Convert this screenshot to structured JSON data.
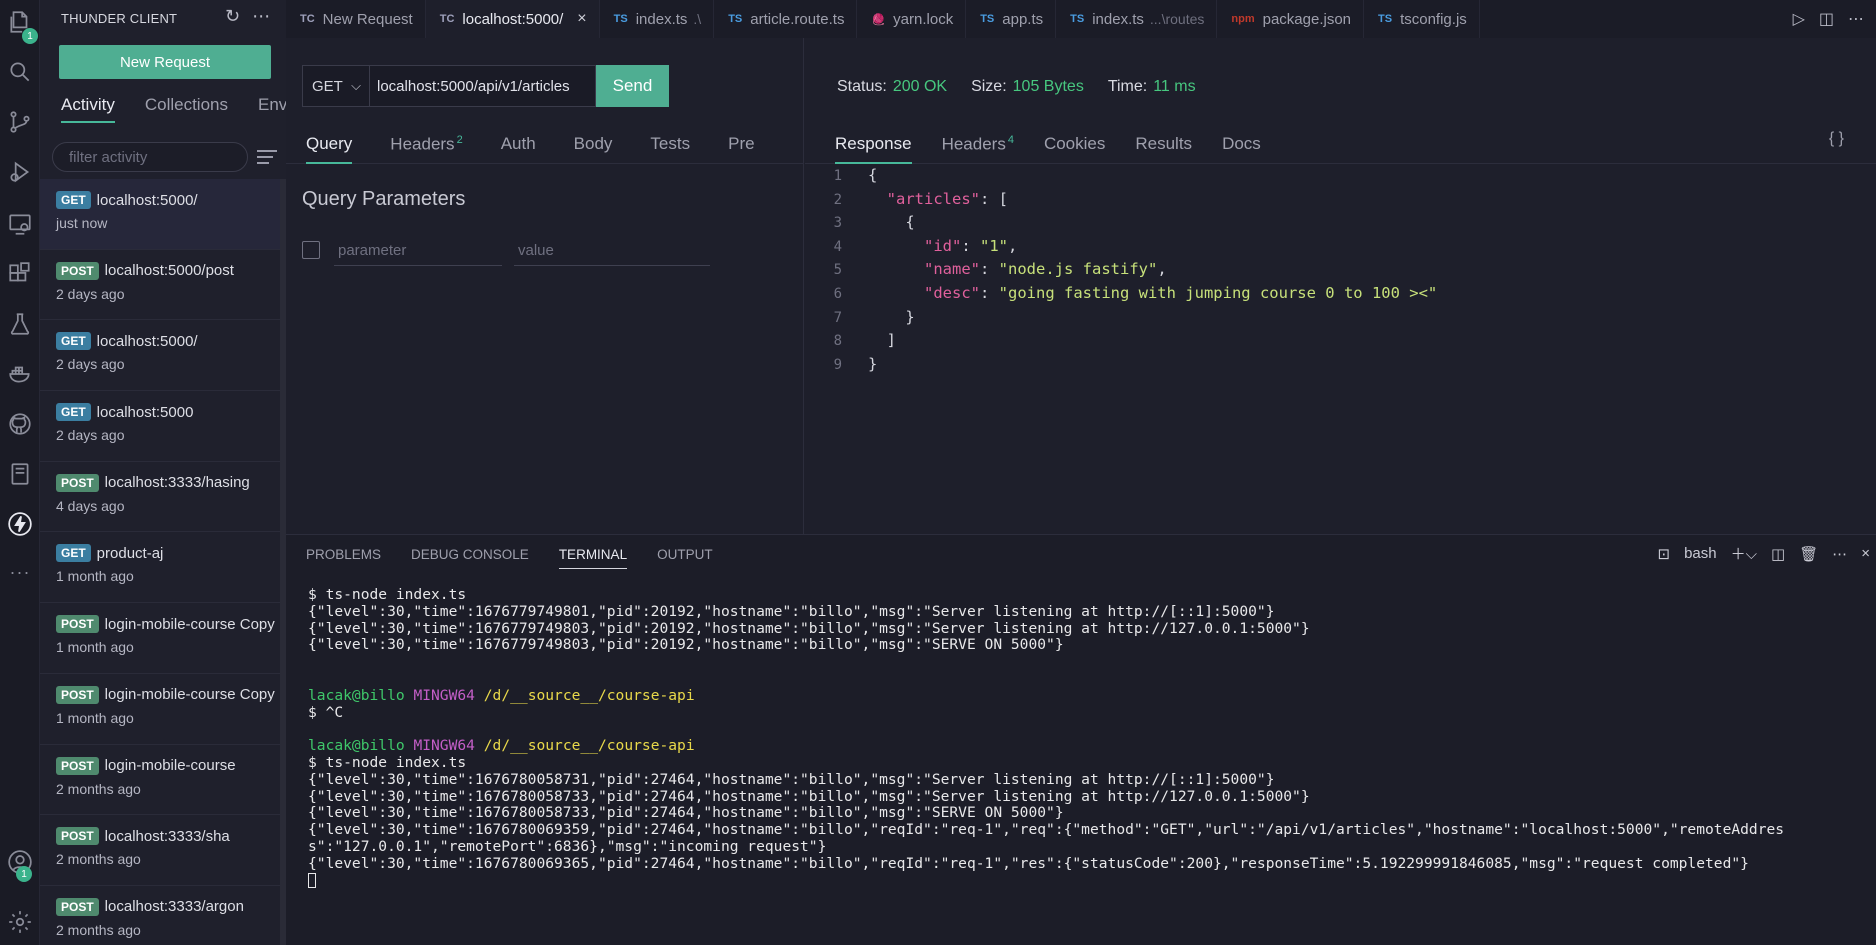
{
  "activity_bar": {
    "explorer_badge": "1",
    "account_badge": "1"
  },
  "sidebar": {
    "title": "THUNDER CLIENT",
    "new_request": "New Request",
    "tabs": [
      "Activity",
      "Collections",
      "Env"
    ],
    "filter_placeholder": "filter activity",
    "items": [
      {
        "method": "GET",
        "url": "localhost:5000/",
        "time": "just now"
      },
      {
        "method": "POST",
        "url": "localhost:5000/post",
        "time": "2 days ago"
      },
      {
        "method": "GET",
        "url": "localhost:5000/",
        "time": "2 days ago"
      },
      {
        "method": "GET",
        "url": "localhost:5000",
        "time": "2 days ago"
      },
      {
        "method": "POST",
        "url": "localhost:3333/hasing",
        "time": "4 days ago"
      },
      {
        "method": "GET",
        "url": "product-aj",
        "time": "1 month ago"
      },
      {
        "method": "POST",
        "url": "login-mobile-course Copy ...",
        "time": "1 month ago"
      },
      {
        "method": "POST",
        "url": "login-mobile-course Copy",
        "time": "1 month ago"
      },
      {
        "method": "POST",
        "url": "login-mobile-course",
        "time": "2 months ago"
      },
      {
        "method": "POST",
        "url": "localhost:3333/sha",
        "time": "2 months ago"
      },
      {
        "method": "POST",
        "url": "localhost:3333/argon",
        "time": "2 months ago"
      }
    ]
  },
  "editor_tabs": [
    {
      "lang": "TC",
      "label": "New Request",
      "hint": ""
    },
    {
      "lang": "TC",
      "label": "localhost:5000/",
      "hint": "",
      "active": true
    },
    {
      "lang": "TS",
      "label": "index.ts",
      "hint": ".\\"
    },
    {
      "lang": "TS",
      "label": "article.route.ts",
      "hint": ""
    },
    {
      "lang": "yarn",
      "label": "yarn.lock",
      "hint": ""
    },
    {
      "lang": "TS",
      "label": "app.ts",
      "hint": ""
    },
    {
      "lang": "TS",
      "label": "index.ts",
      "hint": "...\\routes"
    },
    {
      "lang": "npm",
      "label": "package.json",
      "hint": ""
    },
    {
      "lang": "TS",
      "label": "tsconfig.js",
      "hint": ""
    }
  ],
  "request": {
    "method": "GET",
    "url": "localhost:5000/api/v1/articles",
    "send": "Send",
    "tabs": [
      {
        "label": "Query",
        "count": ""
      },
      {
        "label": "Headers",
        "count": "2"
      },
      {
        "label": "Auth",
        "count": ""
      },
      {
        "label": "Body",
        "count": ""
      },
      {
        "label": "Tests",
        "count": ""
      },
      {
        "label": "Pre",
        "count": ""
      }
    ],
    "query_title": "Query Parameters",
    "param_placeholder": "parameter",
    "value_placeholder": "value"
  },
  "response": {
    "status_label": "Status:",
    "status": "200 OK",
    "size_label": "Size:",
    "size": "105 Bytes",
    "time_label": "Time:",
    "time": "11 ms",
    "tabs": [
      {
        "label": "Response",
        "count": ""
      },
      {
        "label": "Headers",
        "count": "4"
      },
      {
        "label": "Cookies",
        "count": ""
      },
      {
        "label": "Results",
        "count": ""
      },
      {
        "label": "Docs",
        "count": ""
      }
    ],
    "braces": "{ }",
    "body_lines": [
      "{",
      "  \"articles\": [",
      "    {",
      "      \"id\": \"1\",",
      "      \"name\": \"node.js fastify\",",
      "      \"desc\": \"going fasting with jumping course 0 to 100 ><\"",
      "    }",
      "  ]",
      "}"
    ]
  },
  "panel": {
    "tabs": [
      "PROBLEMS",
      "DEBUG CONSOLE",
      "TERMINAL",
      "OUTPUT"
    ],
    "shell": "bash",
    "terminal_lines": [
      "$ ts-node index.ts",
      "{\"level\":30,\"time\":1676779749801,\"pid\":20192,\"hostname\":\"billo\",\"msg\":\"Server listening at http://[::1]:5000\"}",
      "{\"level\":30,\"time\":1676779749803,\"pid\":20192,\"hostname\":\"billo\",\"msg\":\"Server listening at http://127.0.0.1:5000\"}",
      "{\"level\":30,\"time\":1676779749803,\"pid\":20192,\"hostname\":\"billo\",\"msg\":\"SERVE ON 5000\"}",
      "",
      "",
      "PROMPT",
      "$ ^C",
      "",
      "PROMPT",
      "$ ts-node index.ts",
      "{\"level\":30,\"time\":1676780058731,\"pid\":27464,\"hostname\":\"billo\",\"msg\":\"Server listening at http://[::1]:5000\"}",
      "{\"level\":30,\"time\":1676780058733,\"pid\":27464,\"hostname\":\"billo\",\"msg\":\"Server listening at http://127.0.0.1:5000\"}",
      "{\"level\":30,\"time\":1676780058733,\"pid\":27464,\"hostname\":\"billo\",\"msg\":\"SERVE ON 5000\"}",
      "{\"level\":30,\"time\":1676780069359,\"pid\":27464,\"hostname\":\"billo\",\"reqId\":\"req-1\",\"req\":{\"method\":\"GET\",\"url\":\"/api/v1/articles\",\"hostname\":\"localhost:5000\",\"remoteAddres",
      "s\":\"127.0.0.1\",\"remotePort\":6836},\"msg\":\"incoming request\"}",
      "{\"level\":30,\"time\":1676780069365,\"pid\":27464,\"hostname\":\"billo\",\"reqId\":\"req-1\",\"res\":{\"statusCode\":200},\"responseTime\":5.192299991846085,\"msg\":\"request completed\"}"
    ],
    "prompt_user": "lacak@billo",
    "prompt_env": "MINGW64",
    "prompt_path": "/d/__source__/course-api"
  }
}
